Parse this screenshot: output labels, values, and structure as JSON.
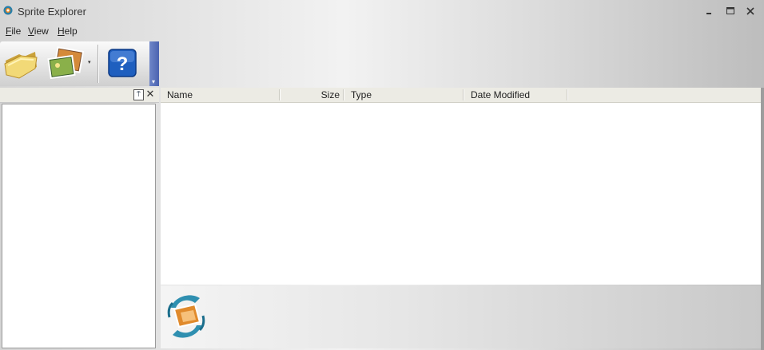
{
  "window": {
    "title": "Sprite Explorer",
    "controls": {
      "minimize": "–",
      "maximize": "□",
      "close": "✕"
    }
  },
  "menu": {
    "items": [
      {
        "label": "File"
      },
      {
        "label": "View"
      },
      {
        "label": "Help"
      }
    ]
  },
  "toolbar": {
    "buttons": [
      {
        "icon": "open-folder-icon"
      },
      {
        "icon": "images-icon",
        "has_dropdown": true
      },
      {
        "icon": "help-icon"
      }
    ],
    "dropdown_glyph": "▾",
    "overflow_glyph": "▾"
  },
  "left_panel": {
    "pin_glyph": "⍑",
    "close_glyph": "✕"
  },
  "list": {
    "columns": [
      {
        "label": "Name"
      },
      {
        "label": "Size"
      },
      {
        "label": "Type"
      },
      {
        "label": "Date Modified"
      }
    ]
  },
  "colors": {
    "accent": "#1f5fbf",
    "header_bg": "#ecebe4",
    "grip": "#5a72bb"
  }
}
